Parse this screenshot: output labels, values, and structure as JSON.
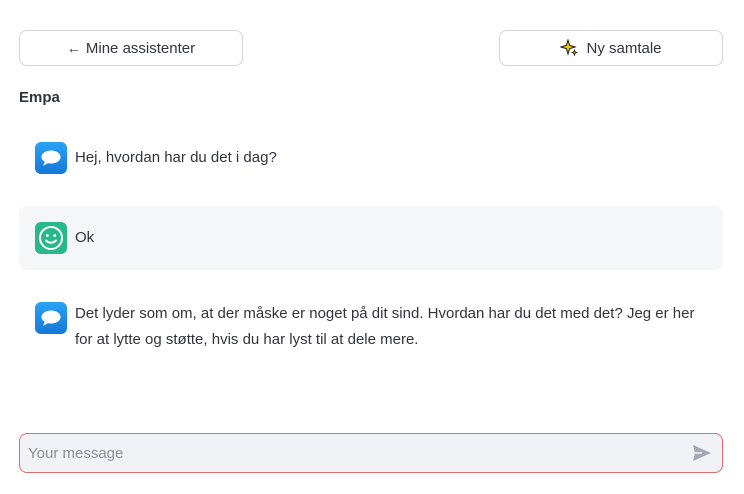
{
  "header": {
    "back_label": "Mine assistenter",
    "back_arrow": "←",
    "new_chat_label": "Ny samtale"
  },
  "assistant": {
    "name": "Empa"
  },
  "messages": [
    {
      "role": "assistant",
      "avatar": "speech-bubble-icon",
      "text": "Hej, hvordan har du det i dag?"
    },
    {
      "role": "user",
      "avatar": "smiley-icon",
      "text": "Ok"
    },
    {
      "role": "assistant",
      "avatar": "speech-bubble-icon",
      "text": "Det lyder som om, at der måske er noget på dit sind. Hvordan har du det med det? Jeg er her for at lytte og støtte, hvis du har lyst til at dele mere."
    }
  ],
  "composer": {
    "placeholder": "Your message",
    "value": ""
  },
  "colors": {
    "user_avatar": "#27b98a",
    "assistant_avatar": "#1e88e5",
    "composer_border": "#e06c6c",
    "user_message_bg": "#f5f6f8"
  }
}
